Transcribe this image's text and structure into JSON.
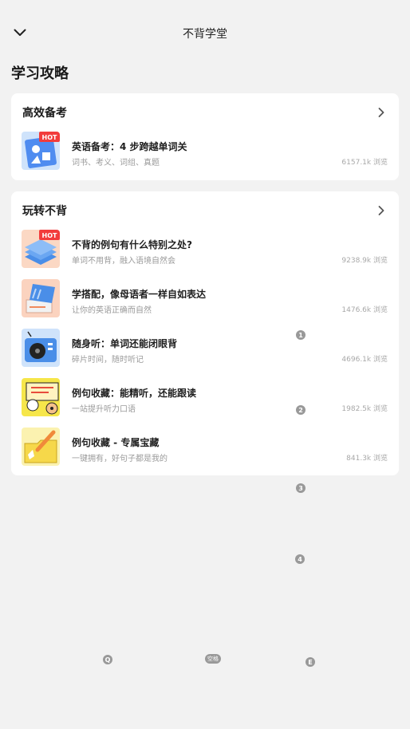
{
  "header": {
    "title": "不背学堂",
    "back_icon": "chevron-down-icon"
  },
  "page": {
    "title": "学习攻略"
  },
  "sections": [
    {
      "title": "高效备考",
      "items": [
        {
          "title": "英语备考：4 步跨越单词关",
          "subtitle": "词书、考义、词组、真题",
          "views": "6157.1k 浏览",
          "badge": "HOT"
        }
      ]
    },
    {
      "title": "玩转不背",
      "items": [
        {
          "title": "不背的例句有什么特别之处?",
          "subtitle": "单词不用背，融入语境自然会",
          "views": "9238.9k 浏览",
          "badge": "HOT"
        },
        {
          "title": "学搭配，像母语者一样自如表达",
          "subtitle": "让你的英语正确而自然",
          "views": "1476.6k 浏览"
        },
        {
          "title": "随身听：单词还能闭眼背",
          "subtitle": "碎片时间，随时听记",
          "views": "4696.1k 浏览"
        },
        {
          "title": "例句收藏：能精听，还能跟读",
          "subtitle": "一站提升听力口语",
          "views": "1982.5k 浏览"
        },
        {
          "title": "例句收藏 - 专属宝藏",
          "subtitle": "一键拥有，好句子都是我的",
          "views": "841.3k 浏览"
        }
      ]
    }
  ],
  "markers": [
    "1",
    "2",
    "3",
    "4",
    "Q",
    "空格",
    "E"
  ],
  "colors": {
    "hot_badge": "#f23c3c",
    "background": "#f2f2f2",
    "marker": "#999999"
  }
}
